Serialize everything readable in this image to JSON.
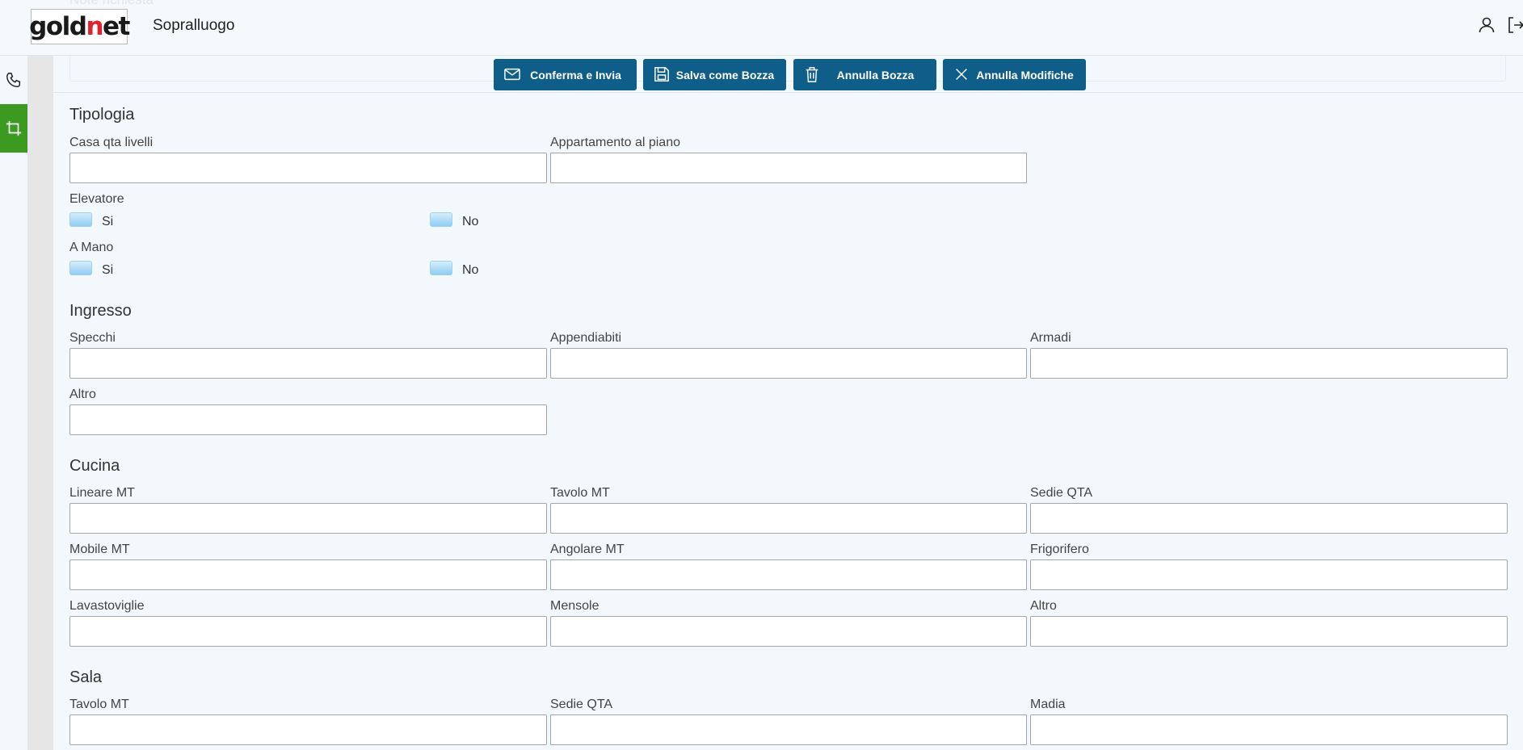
{
  "app": {
    "logo_prefix": "gold",
    "logo_accent": "n",
    "logo_suffix": "et",
    "page_title": "Sopralluogo",
    "ghost_label": "Note richiesta"
  },
  "header_icons": [
    "user-icon",
    "logout-icon"
  ],
  "rail": {
    "items": [
      {
        "name": "phone-icon",
        "active": false
      },
      {
        "name": "crop-icon",
        "active": true
      }
    ],
    "active_color": "#3b9a1f"
  },
  "toolbar": {
    "confirm_label": "Conferma e Invia",
    "save_draft_label": "Salva come Bozza",
    "cancel_draft_label": "Annulla Bozza",
    "cancel_changes_label": "Annulla Modifiche",
    "button_color": "#0f5e8a"
  },
  "form": {
    "tipologia": {
      "title": "Tipologia",
      "casa_qta_livelli": {
        "label": "Casa qta livelli",
        "value": ""
      },
      "appartamento_al_piano": {
        "label": "Appartamento al piano",
        "value": ""
      },
      "elevatore": {
        "label": "Elevatore",
        "yes": "Si",
        "no": "No"
      },
      "a_mano": {
        "label": "A Mano",
        "yes": "Si",
        "no": "No"
      }
    },
    "ingresso": {
      "title": "Ingresso",
      "specchi": {
        "label": "Specchi",
        "value": ""
      },
      "appendiabiti": {
        "label": "Appendiabiti",
        "value": ""
      },
      "armadi": {
        "label": "Armadi",
        "value": ""
      },
      "altro": {
        "label": "Altro",
        "value": ""
      }
    },
    "cucina": {
      "title": "Cucina",
      "lineare_mt": {
        "label": "Lineare MT",
        "value": ""
      },
      "tavolo_mt": {
        "label": "Tavolo MT",
        "value": ""
      },
      "sedie_qta": {
        "label": "Sedie QTA",
        "value": ""
      },
      "mobile_mt": {
        "label": "Mobile MT",
        "value": ""
      },
      "angolare_mt": {
        "label": "Angolare MT",
        "value": ""
      },
      "frigorifero": {
        "label": "Frigorifero",
        "value": ""
      },
      "lavastoviglie": {
        "label": "Lavastoviglie",
        "value": ""
      },
      "mensole": {
        "label": "Mensole",
        "value": ""
      },
      "altro": {
        "label": "Altro",
        "value": ""
      }
    },
    "sala": {
      "title": "Sala",
      "tavolo_mt": {
        "label": "Tavolo MT",
        "value": ""
      },
      "sedie_qta": {
        "label": "Sedie QTA",
        "value": ""
      },
      "madia": {
        "label": "Madia",
        "value": ""
      }
    }
  }
}
